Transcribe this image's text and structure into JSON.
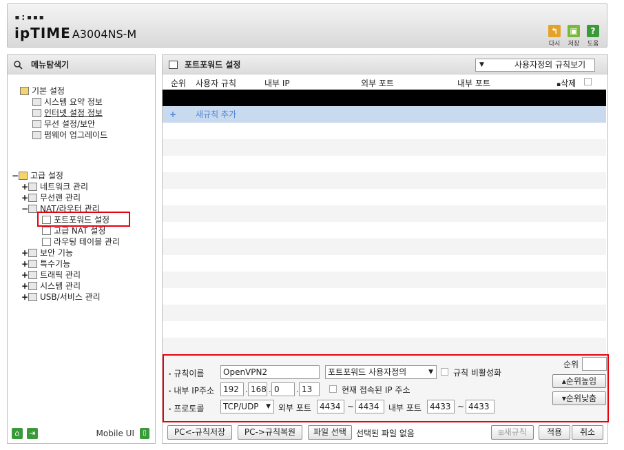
{
  "header": {
    "logo_dots": "▪:▪▪▪",
    "brand": "ipTIME",
    "model": "A3004NS-M",
    "buttons": [
      {
        "label": "다시",
        "icon": "refresh-icon",
        "color": "#e3a32b"
      },
      {
        "label": "저장",
        "icon": "save-icon",
        "color": "#7ab83a"
      },
      {
        "label": "도움",
        "icon": "help-icon",
        "color": "#3a9a3a"
      }
    ]
  },
  "left": {
    "title": "메뉴탐색기",
    "basic": {
      "label": "기본 설정",
      "items": [
        "시스템 요약 정보",
        "인터넷 설정 정보",
        "무선 설정/보안",
        "펌웨어 업그레이드"
      ]
    },
    "advanced": {
      "label": "고급 설정",
      "items": [
        "네트워크 관리",
        "무선랜 관리",
        "NAT/라우터 관리"
      ],
      "nat_children": [
        "포트포워드 설정",
        "고급 NAT 설정",
        "라우팅 테이블 관리"
      ],
      "more_items": [
        "보안 기능",
        "특수기능",
        "트래픽 관리",
        "시스템 관리",
        "USB/서비스 관리"
      ]
    },
    "mobile_label": "Mobile UI"
  },
  "right": {
    "title": "포트포워드 설정",
    "view_select": "사용자정의 규칙보기",
    "columns": [
      "순위",
      "사용자 규칙",
      "내부 IP",
      "외부 포트",
      "내부 포트",
      "삭제"
    ],
    "add_rule": "새규칙 추가",
    "add_plus": "+"
  },
  "form": {
    "rule_name_label": "규칙이름",
    "rule_name_value": "OpenVPN2",
    "rule_type": "포트포워드 사용자정의",
    "disable_label": "규칙 비활성화",
    "ip_label": "내부 IP주소",
    "ip": [
      "192",
      "168",
      "0",
      "13"
    ],
    "current_ip_label": "현재 접속된 IP 주소",
    "protocol_label": "프로토콜",
    "protocol": "TCP/UDP",
    "ext_port_label": "외부 포트",
    "ext_port_from": "4434",
    "ext_port_to": "4434",
    "int_port_label": "내부 포트",
    "int_port_from": "4433",
    "int_port_to": "4433",
    "tilde": "~",
    "rank_label": "순위",
    "rank_up": "▴순위높임",
    "rank_down": "▾순위낮춤"
  },
  "bottom": {
    "save_pc": "PC<-규칙저장",
    "restore_pc": "PC->규칙복원",
    "file_select": "파일 선택",
    "no_file": "선택된 파일 없음",
    "new_rule": "새규칙",
    "apply": "적용",
    "cancel": "취소"
  }
}
